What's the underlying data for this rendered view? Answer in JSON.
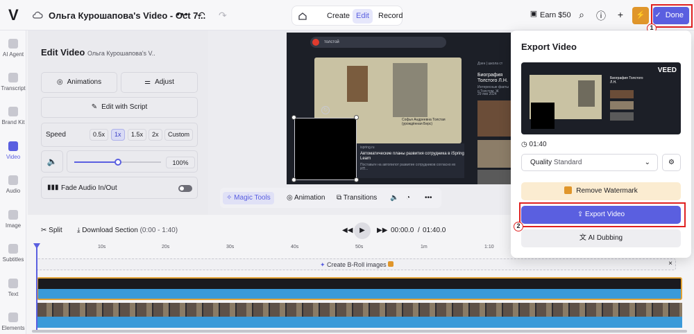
{
  "header": {
    "logo": "V",
    "project_title": "Ольга Курошапова's Video - Oct 7...",
    "more": "•••",
    "modes": [
      {
        "label": "Create",
        "active": false
      },
      {
        "label": "Edit",
        "active": true
      },
      {
        "label": "Record",
        "active": false
      }
    ],
    "earn_label": "Earn $50",
    "done_label": "Done",
    "step1": "1",
    "step2": "2"
  },
  "nav": {
    "items": [
      {
        "label": "AI Agent",
        "active": false
      },
      {
        "label": "Transcript",
        "active": false
      },
      {
        "label": "Brand Kit",
        "active": false
      },
      {
        "label": "Video",
        "active": true
      },
      {
        "label": "Audio",
        "active": false
      },
      {
        "label": "Image",
        "active": false
      },
      {
        "label": "Subtitles",
        "active": false
      },
      {
        "label": "Text",
        "active": false
      },
      {
        "label": "Elements",
        "active": false
      }
    ]
  },
  "edit_panel": {
    "title": "Edit Video",
    "subtitle": "Ольга Курошапова's V..",
    "animations_label": "Animations",
    "adjust_label": "Adjust",
    "script_label": "Edit with Script",
    "speed_label": "Speed",
    "speed_options": [
      "0.5x",
      "1x",
      "1.5x",
      "2x",
      "Custom"
    ],
    "speed_selected": "1x",
    "volume_value": "100%",
    "volume_fraction": 0.5,
    "fade_label": "Fade Audio In/Out",
    "fade_on": false
  },
  "preview": {
    "search_text": "толстой",
    "caption": "Софья Андреевна Толстая (урождённая Берс)",
    "card_source": "ispring.ru",
    "card_title": "Автоматические планы развития сотрудника в iSpring Learn",
    "card_sub": "Поставьте на автопилот развитие сотрудников согласно их ИП...",
    "right_title": "Биография Толстого Л.Н.",
    "right_title_top": "Дзен | школа ст",
    "right_sub": "Интересные факты о Толстом. Ж",
    "right_date": "29 янв 2024"
  },
  "magic_bar": {
    "magic_tools": "Magic Tools",
    "animation": "Animation",
    "transitions": "Transitions"
  },
  "timeline": {
    "split_label": "Split",
    "download_label": "Download Section",
    "download_range": "(0:00 - 1:40)",
    "current_time": "00:00.0",
    "separator": "/",
    "total_time": "01:40.0",
    "ticks": [
      "10s",
      "20s",
      "30s",
      "40s",
      "50s",
      "1m",
      "1:10"
    ],
    "broll_label": "Create B-Roll images"
  },
  "export_modal": {
    "title": "Export Video",
    "watermark": "VEED",
    "duration": "01:40",
    "quality_label": "Quality",
    "quality_value": "Standard",
    "remove_watermark_label": "Remove Watermark",
    "export_label": "Export Video",
    "dubbing_label": "AI Dubbing"
  },
  "colors": {
    "accent": "#5a5fe0",
    "highlight": "#e02020",
    "upgrade": "#e0962b"
  }
}
